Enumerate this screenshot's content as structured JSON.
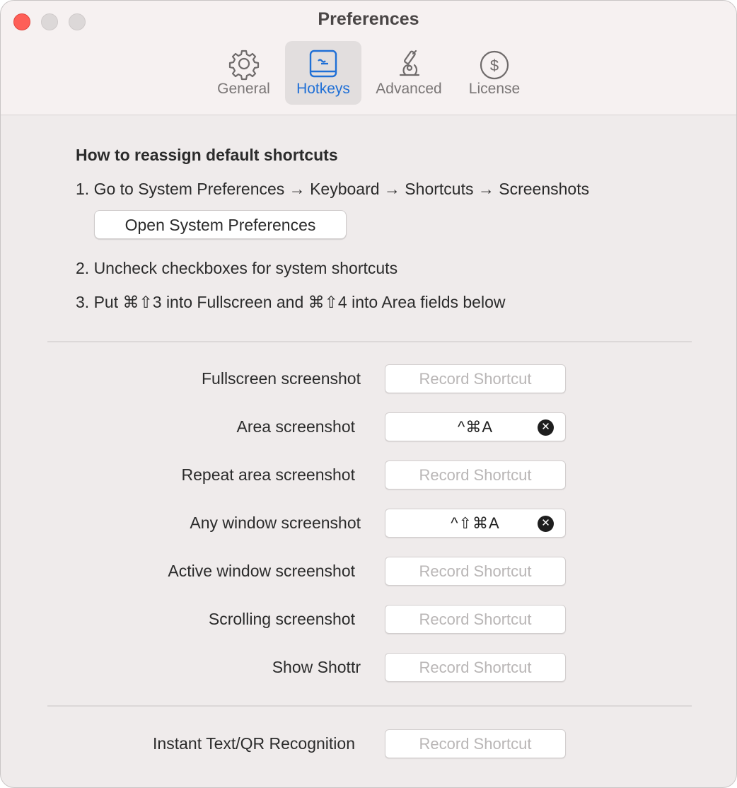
{
  "window": {
    "title": "Preferences"
  },
  "tabs": [
    {
      "label": "General",
      "icon": "gear-icon",
      "active": false
    },
    {
      "label": "Hotkeys",
      "icon": "keyboard-icon",
      "active": true
    },
    {
      "label": "Advanced",
      "icon": "microscope-icon",
      "active": false
    },
    {
      "label": "License",
      "icon": "dollar-circle-icon",
      "active": false
    }
  ],
  "instructions": {
    "title": "How to reassign default shortcuts",
    "step1": "1. Go to System Preferences → Keyboard → Shortcuts → Screenshots",
    "button": "Open System Preferences",
    "step2": "2. Uncheck checkboxes for system shortcuts",
    "step3": "3. Put ⌘⇧3 into Fullscreen and ⌘⇧4 into Area fields below"
  },
  "shortcuts": [
    {
      "label": "Fullscreen screenshot",
      "value": "",
      "placeholder": "Record Shortcut"
    },
    {
      "label": "Area screenshot",
      "value": "^⌘A",
      "placeholder": "Record Shortcut"
    },
    {
      "label": "Repeat area screenshot",
      "value": "",
      "placeholder": "Record Shortcut"
    },
    {
      "label": "Any window screenshot",
      "value": "^⇧⌘A",
      "placeholder": "Record Shortcut"
    },
    {
      "label": "Active window screenshot",
      "value": "",
      "placeholder": "Record Shortcut"
    },
    {
      "label": "Scrolling screenshot",
      "value": "",
      "placeholder": "Record Shortcut"
    },
    {
      "label": "Show Shottr",
      "value": "",
      "placeholder": "Record Shortcut"
    }
  ],
  "extra_shortcut": {
    "label": "Instant Text/QR Recognition",
    "value": "",
    "placeholder": "Record Shortcut"
  },
  "colors": {
    "accent": "#1f6fd6",
    "close": "#fe5f57",
    "background": "#efebeb"
  }
}
